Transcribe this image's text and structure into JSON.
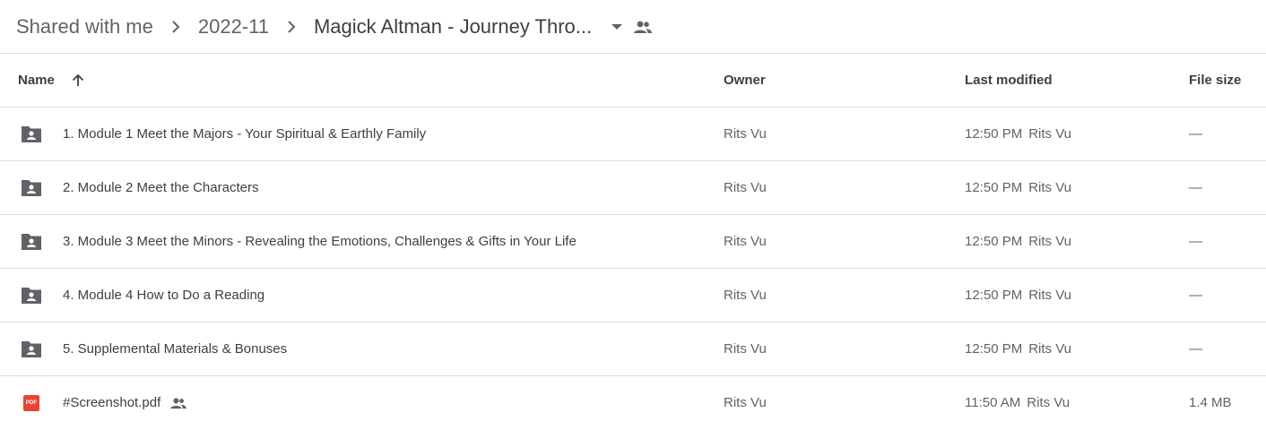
{
  "breadcrumb": {
    "items": [
      "Shared with me",
      "2022-11"
    ],
    "current": "Magick Altman - Journey Thro..."
  },
  "columns": {
    "name": "Name",
    "owner": "Owner",
    "last_modified": "Last modified",
    "file_size": "File size"
  },
  "sort": {
    "column": "Name",
    "direction": "ascending",
    "icon": "arrow-up-icon"
  },
  "rows": [
    {
      "type": "folder",
      "icon": "shared-folder-icon",
      "name": "1. Module 1 Meet the Majors - Your Spiritual & Earthly Family",
      "owner": "Rits Vu",
      "modified_time": "12:50 PM",
      "modified_by": "Rits Vu",
      "size": "—"
    },
    {
      "type": "folder",
      "icon": "shared-folder-icon",
      "name": "2. Module 2 Meet the Characters",
      "owner": "Rits Vu",
      "modified_time": "12:50 PM",
      "modified_by": "Rits Vu",
      "size": "—"
    },
    {
      "type": "folder",
      "icon": "shared-folder-icon",
      "name": "3. Module 3 Meet the Minors - Revealing the Emotions, Challenges & Gifts in Your Life",
      "owner": "Rits Vu",
      "modified_time": "12:50 PM",
      "modified_by": "Rits Vu",
      "size": "—"
    },
    {
      "type": "folder",
      "icon": "shared-folder-icon",
      "name": "4. Module 4 How to Do a Reading",
      "owner": "Rits Vu",
      "modified_time": "12:50 PM",
      "modified_by": "Rits Vu",
      "size": "—"
    },
    {
      "type": "folder",
      "icon": "shared-folder-icon",
      "name": "5. Supplemental Materials & Bonuses",
      "owner": "Rits Vu",
      "modified_time": "12:50 PM",
      "modified_by": "Rits Vu",
      "size": "—"
    },
    {
      "type": "pdf",
      "icon": "pdf-icon",
      "badge": "PDF",
      "name": "#Screenshot.pdf",
      "shared_icon": "people-icon",
      "owner": "Rits Vu",
      "modified_time": "11:50 AM",
      "modified_by": "Rits Vu",
      "size": "1.4 MB"
    }
  ],
  "colors": {
    "text": "#3c4043",
    "muted": "#5f6368",
    "divider": "#dadce0",
    "pdf_red": "#ea4335"
  }
}
